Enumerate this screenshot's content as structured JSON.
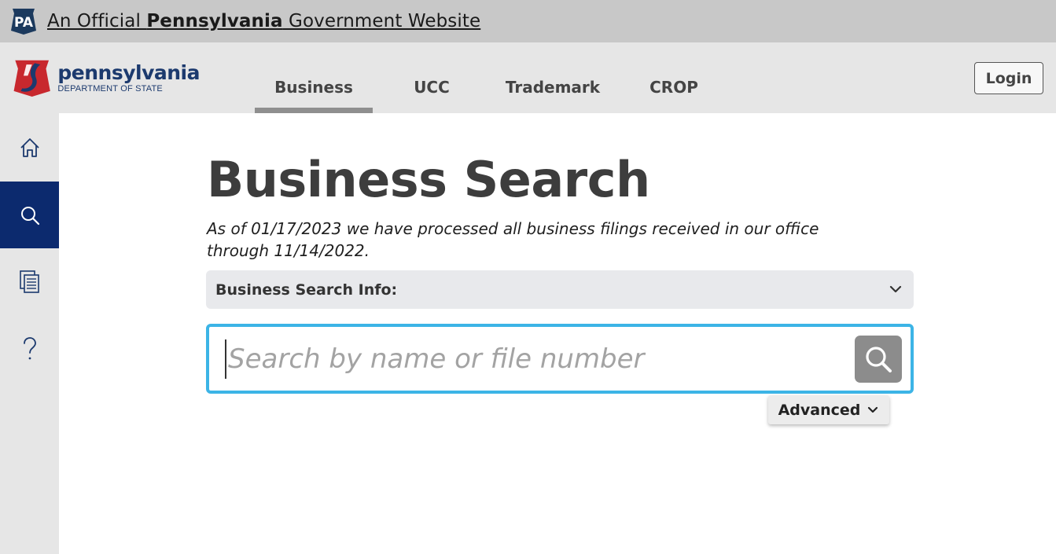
{
  "banner": {
    "prefix": "An Official ",
    "state": "Pennsylvania",
    "suffix": " Government Website",
    "badge": "PA"
  },
  "logo": {
    "name": "pennsylvania",
    "department": "DEPARTMENT OF STATE"
  },
  "nav": {
    "tabs": [
      {
        "label": "Business",
        "active": true
      },
      {
        "label": "UCC",
        "active": false
      },
      {
        "label": "Trademark",
        "active": false
      },
      {
        "label": "CROP",
        "active": false
      }
    ]
  },
  "header": {
    "login_label": "Login"
  },
  "sidebar": {
    "items": [
      {
        "icon": "home-icon",
        "active": false
      },
      {
        "icon": "search-icon",
        "active": true
      },
      {
        "icon": "documents-icon",
        "active": false
      },
      {
        "icon": "help-icon",
        "active": false
      }
    ]
  },
  "main": {
    "title": "Business Search",
    "notice": "As of 01/17/2023 we have processed all business filings received in our office through 11/14/2022.",
    "info_label": "Business Search Info:",
    "search_placeholder": "Search by name or file number",
    "search_value": "",
    "advanced_label": "Advanced"
  },
  "colors": {
    "navy": "#0c2a6e",
    "accent_border": "#3cb4e6",
    "search_button": "#8c8c8c",
    "banner_bg": "#c8c8c8",
    "header_bg": "#e6e6e6"
  }
}
